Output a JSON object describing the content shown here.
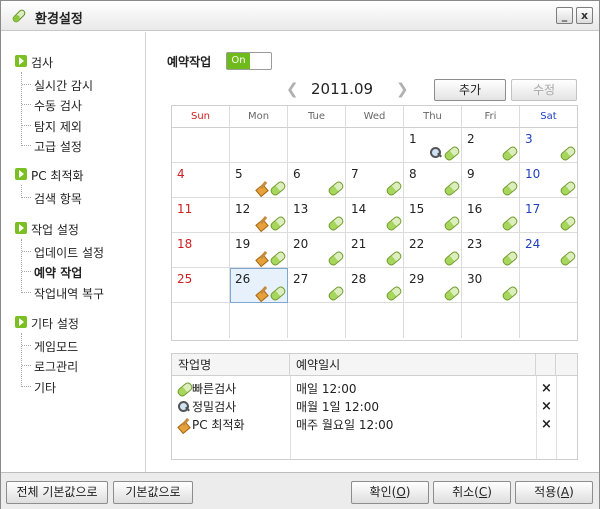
{
  "window": {
    "title": "환경설정",
    "minimize_label": "_",
    "close_label": "x"
  },
  "sidebar": {
    "categories": [
      {
        "label": "검사",
        "items": [
          "실시간 감시",
          "수동 검사",
          "탐지 제외",
          "고급 설정"
        ]
      },
      {
        "label": "PC 최적화",
        "items": [
          "검색 항목"
        ]
      },
      {
        "label": "작업 설정",
        "items": [
          "업데이트 설정",
          "예약 작업",
          "작업내역 복구"
        ]
      },
      {
        "label": "기타 설정",
        "items": [
          "게임모드",
          "로그관리",
          "기타"
        ]
      }
    ],
    "active_item": "예약 작업"
  },
  "schedule": {
    "label": "예약작업",
    "toggle_label": "On",
    "toggle_state": "on",
    "month": "2011.09",
    "prev_icon": "chevron-left-icon",
    "next_icon": "chevron-right-icon",
    "add_button": "추가",
    "edit_button": "수정"
  },
  "calendar": {
    "weekdays": [
      "Sun",
      "Mon",
      "Tue",
      "Wed",
      "Thu",
      "Fri",
      "Sat"
    ],
    "weeks": [
      [
        "",
        "",
        "",
        "",
        "1",
        "2",
        "3"
      ],
      [
        "4",
        "5",
        "6",
        "7",
        "8",
        "9",
        "10"
      ],
      [
        "11",
        "12",
        "13",
        "14",
        "15",
        "16",
        "17"
      ],
      [
        "18",
        "19",
        "20",
        "21",
        "22",
        "23",
        "24"
      ],
      [
        "25",
        "26",
        "27",
        "28",
        "29",
        "30",
        ""
      ],
      [
        "",
        "",
        "",
        "",
        "",
        "",
        ""
      ]
    ],
    "selected_day": "26",
    "colors": {
      "sunday": "#cf1f1f",
      "saturday": "#1f3fbf",
      "selection": "#e7f1fb"
    }
  },
  "tasks": {
    "headers": [
      "작업명",
      "예약일시"
    ],
    "rows": [
      {
        "icon": "capsule-icon",
        "name": "빠른검사",
        "when": "매일 12:00",
        "delete": "×"
      },
      {
        "icon": "magnifier-icon",
        "name": "정밀검사",
        "when": "매월 1일 12:00",
        "delete": "×"
      },
      {
        "icon": "broom-icon",
        "name": "PC 최적화",
        "when": "매주 월요일 12:00",
        "delete": "×"
      }
    ]
  },
  "footer": {
    "reset_all": "전체 기본값으로",
    "reset": "기본값으로",
    "ok_label": "확인(",
    "ok_key": "O",
    "ok_end": ")",
    "cancel_label": "취소(",
    "cancel_key": "C",
    "cancel_end": ")",
    "apply_label": "적용(",
    "apply_key": "A",
    "apply_end": ")"
  }
}
